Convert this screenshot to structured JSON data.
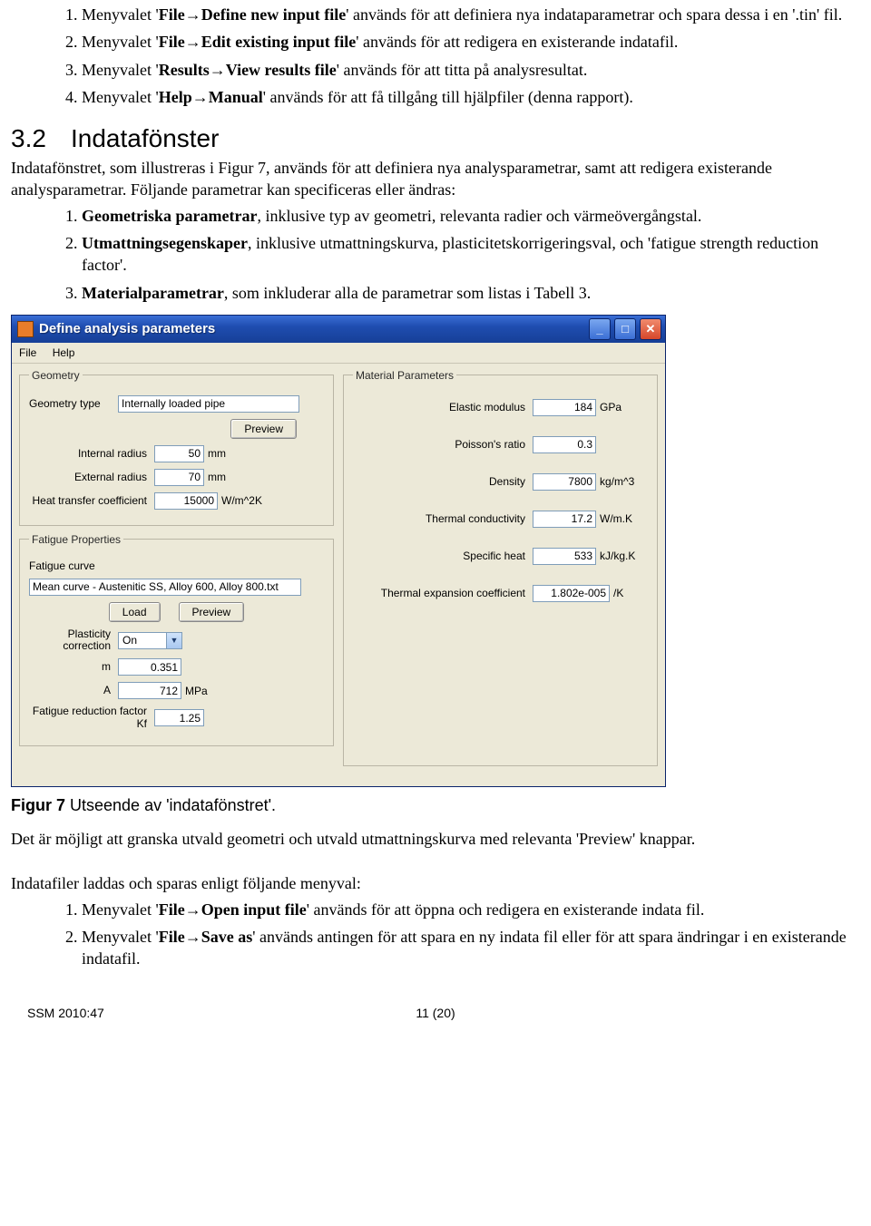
{
  "list1": {
    "i1": {
      "n": "1.",
      "pre": "Menyvalet '",
      "menu": "File",
      "arrow": "→",
      "cmd": "Define new input file",
      "post": "' används för att definiera nya indataparametrar och spara dessa i en '.tin' fil."
    },
    "i2": {
      "n": "2.",
      "pre": "Menyvalet '",
      "menu": "File",
      "arrow": "→",
      "cmd": "Edit existing input file",
      "post": "' används för att redigera en existerande indatafil."
    },
    "i3": {
      "n": "3.",
      "pre": "Menyvalet '",
      "menu": "Results",
      "arrow": "→",
      "cmd": "View results file",
      "post": "' används för att titta på analysresultat."
    },
    "i4": {
      "n": "4.",
      "pre": "Menyvalet '",
      "menu": "Help",
      "arrow": "→",
      "cmd": "Manual",
      "post": "' används för att få tillgång till hjälpfiler (denna rapport)."
    }
  },
  "heading": {
    "num": "3.2",
    "title": "Indatafönster"
  },
  "para1": "Indatafönstret, som illustreras i Figur 7, används för att definiera nya analysparametrar, samt att redigera existerande analysparametrar.  Följande parametrar kan specificeras eller ändras:",
  "list2": {
    "i1": {
      "n": "1.",
      "b": "Geometriska parametrar",
      "rest": ", inklusive typ av geometri, relevanta radier och värmeövergångstal."
    },
    "i2": {
      "n": "2.",
      "b": "Utmattningsegenskaper",
      "rest": ", inklusive utmattningskurva, plasticitetskorrigeringsval, och 'fatigue strength reduction factor'."
    },
    "i3": {
      "n": "3.",
      "b": "Materialparametrar",
      "rest": ", som inkluderar alla de parametrar som listas i Tabell 3."
    }
  },
  "window": {
    "title": "Define analysis parameters",
    "menu": {
      "file": "File",
      "help": "Help"
    },
    "geometry": {
      "legend": "Geometry",
      "type_lbl": "Geometry type",
      "type_val": "Internally loaded pipe",
      "preview": "Preview",
      "ir_lbl": "Internal radius",
      "ir_val": "50",
      "ir_unit": "mm",
      "er_lbl": "External radius",
      "er_val": "70",
      "er_unit": "mm",
      "ht_lbl": "Heat transfer coefficient",
      "ht_val": "15000",
      "ht_unit": "W/m^2K"
    },
    "fatigue": {
      "legend": "Fatigue Properties",
      "curve_lbl": "Fatigue curve",
      "curve_val": "Mean curve - Austenitic SS, Alloy 600, Alloy 800.txt",
      "load": "Load",
      "preview": "Preview",
      "plast_lbl": "Plasticity correction",
      "plast_val": "On",
      "m_lbl": "m",
      "m_val": "0.351",
      "a_lbl": "A",
      "a_val": "712",
      "a_unit": "MPa",
      "kf_lbl": "Fatigue reduction factor Kf",
      "kf_val": "1.25"
    },
    "material": {
      "legend": "Material Parameters",
      "em_lbl": "Elastic modulus",
      "em_val": "184",
      "em_unit": "GPa",
      "pr_lbl": "Poisson's ratio",
      "pr_val": "0.3",
      "rho_lbl": "Density",
      "rho_val": "7800",
      "rho_unit": "kg/m^3",
      "tc_lbl": "Thermal conductivity",
      "tc_val": "17.2",
      "tc_unit": "W/m.K",
      "sh_lbl": "Specific heat",
      "sh_val": "533",
      "sh_unit": "kJ/kg.K",
      "te_lbl": "Thermal expansion coefficient",
      "te_val": "1.802e-005",
      "te_unit": "/K"
    }
  },
  "caption": {
    "b": "Figur 7",
    "rest": " Utseende av 'indatafönstret'."
  },
  "para2": "Det är möjligt att granska utvald geometri och  utvald utmattningskurva med relevanta 'Preview' knappar.",
  "para3": "Indatafiler laddas och sparas enligt följande menyval:",
  "list3": {
    "i1": {
      "n": "1.",
      "pre": "Menyvalet '",
      "menu": "File",
      "arrow": "→",
      "cmd": "Open input file",
      "post": "' används för att öppna och redigera en existerande indata fil."
    },
    "i2": {
      "n": "2.",
      "pre": "Menyvalet '",
      "menu": "File",
      "arrow": "→",
      "cmd": "Save as",
      "post": "' används antingen för att spara en ny indata fil eller för att spara ändringar i en existerande indatafil."
    }
  },
  "footer": {
    "left": "SSM 2010:47",
    "center": "11 (20)"
  }
}
